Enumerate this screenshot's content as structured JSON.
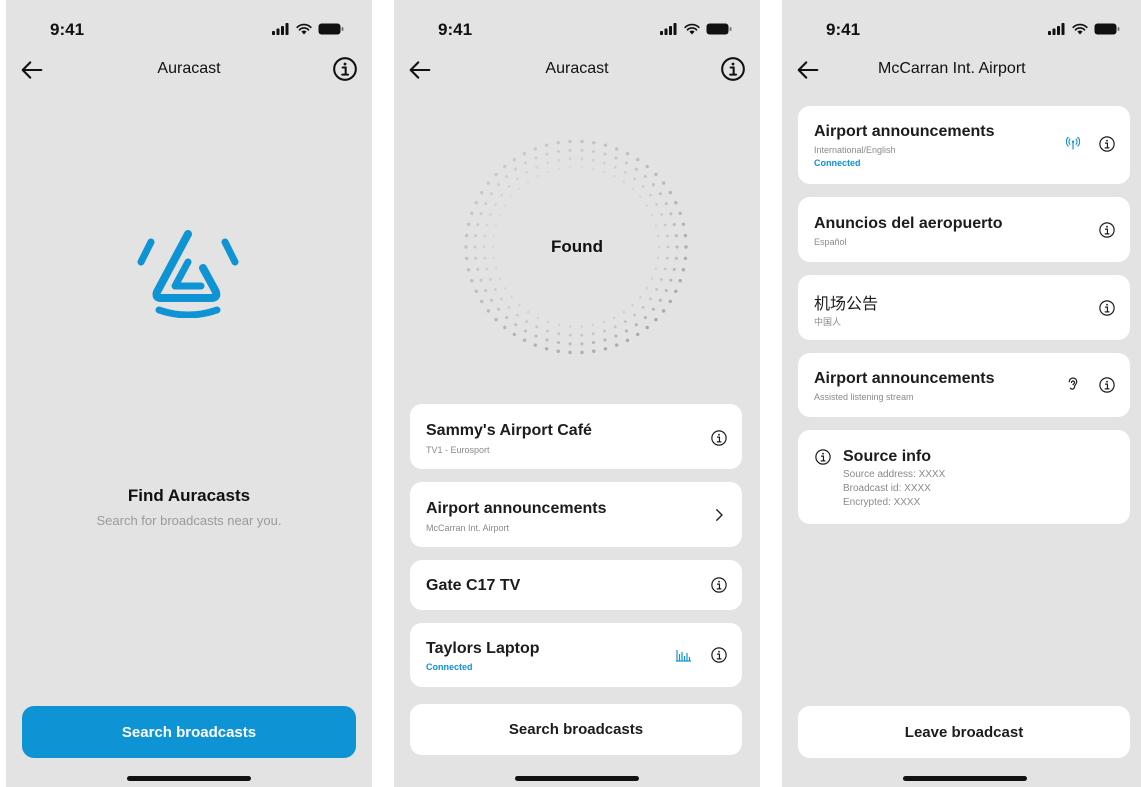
{
  "colors": {
    "accent": "#0e93d4",
    "background": "#e3e3e3",
    "card": "#ffffff"
  },
  "screen1": {
    "status_time": "9:41",
    "nav_title": "Auracast",
    "find_title": "Find Auracasts",
    "find_subtitle": "Search for broadcasts near you.",
    "search_button": "Search broadcasts"
  },
  "screen2": {
    "status_time": "9:41",
    "nav_title": "Auracast",
    "radar_label": "Found",
    "broadcasts": [
      {
        "title": "Sammy's Airport Café",
        "subtitle": "TV1 - Eurosport",
        "status": "",
        "icon": "info-icon"
      },
      {
        "title": "Airport announcements",
        "subtitle": "McCarran Int. Airport",
        "status": "",
        "icon": "chevron-right-icon"
      },
      {
        "title": "Gate C17 TV",
        "subtitle": "",
        "status": "",
        "icon": "info-icon"
      },
      {
        "title": "Taylors Laptop",
        "subtitle": "",
        "status": "Connected",
        "icon": "info-icon",
        "extra_icon": "audio-level-icon"
      }
    ],
    "search_button": "Search broadcasts"
  },
  "screen3": {
    "status_time": "9:41",
    "nav_title": "McCarran Int. Airport",
    "streams": [
      {
        "title": "Airport announcements",
        "subtitle": "International/English",
        "status": "Connected",
        "icon": "info-icon",
        "extra_icon": "broadcast-signal-icon"
      },
      {
        "title": "Anuncios del aeropuerto",
        "subtitle": "Español",
        "status": "",
        "icon": "info-icon"
      },
      {
        "title": "机场公告",
        "subtitle": "中国人",
        "status": "",
        "icon": "info-icon"
      },
      {
        "title": "Airport announcements",
        "subtitle": "Assisted listening stream",
        "status": "",
        "icon": "info-icon",
        "extra_icon": "hearing-assist-icon"
      }
    ],
    "source_info": {
      "title": "Source info",
      "lines": [
        "Source address: XXXX",
        "Broadcast id: XXXX",
        "Encrypted: XXXX"
      ]
    },
    "leave_button": "Leave broadcast"
  }
}
